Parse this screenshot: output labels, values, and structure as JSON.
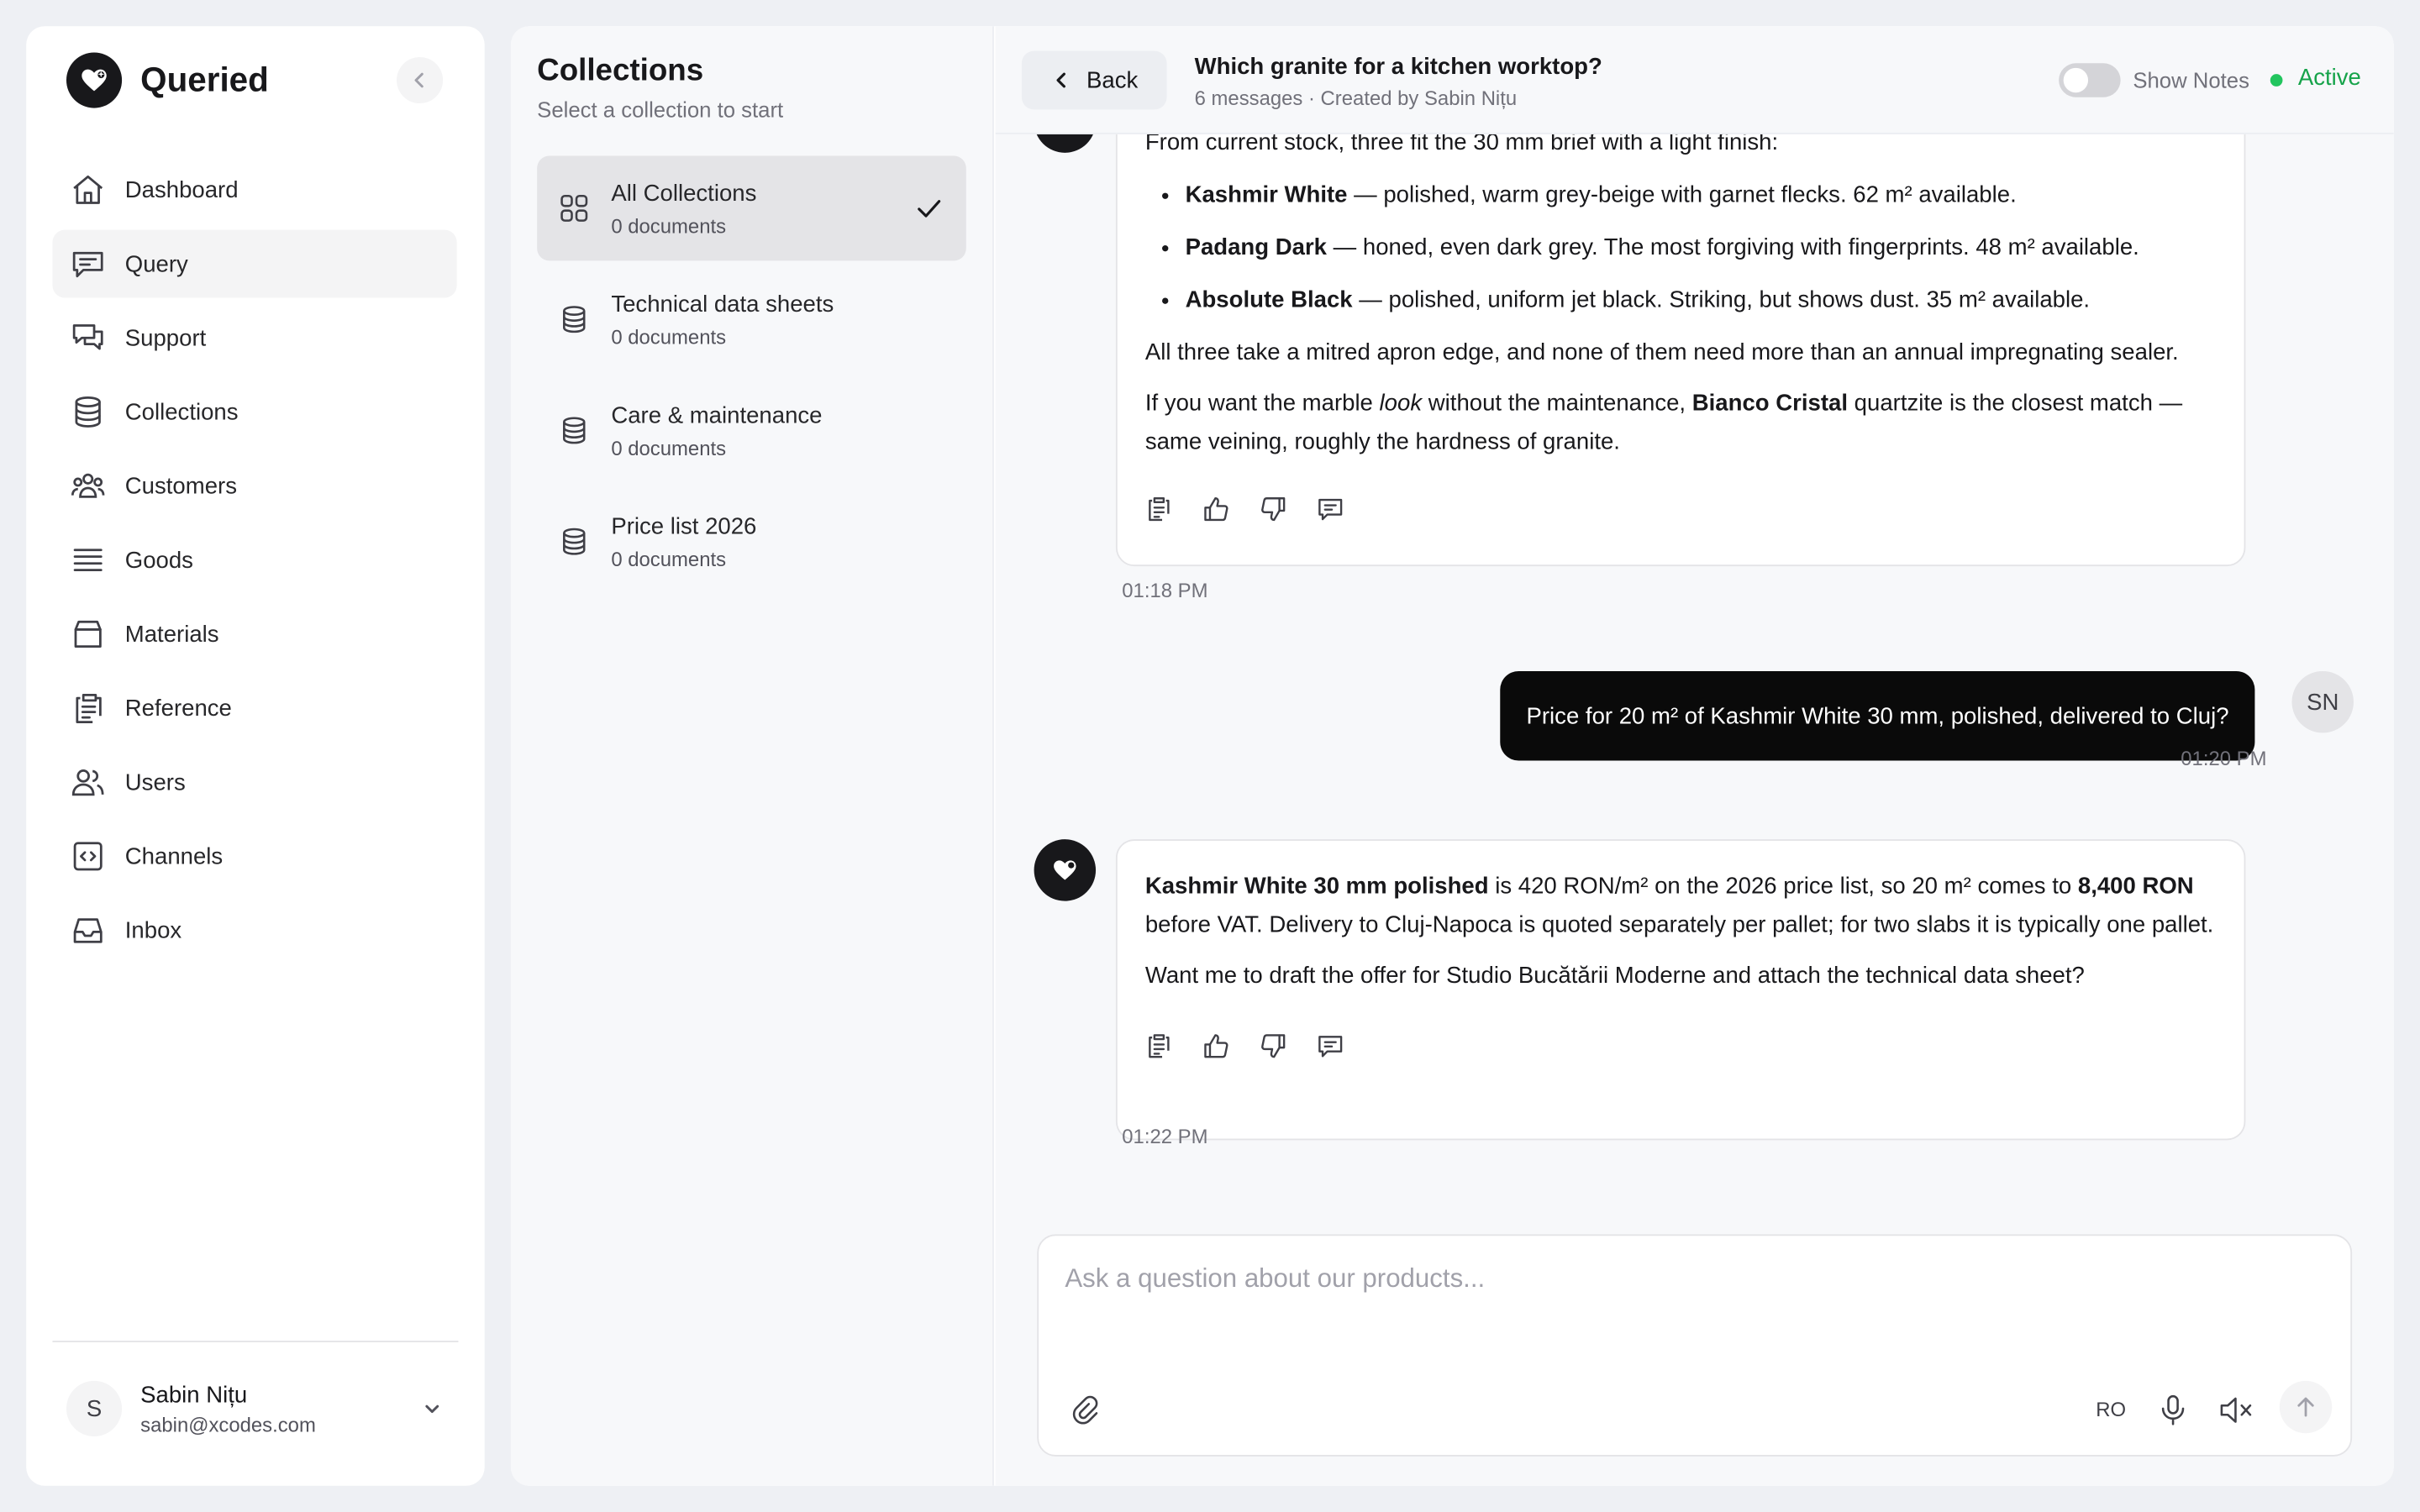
{
  "brand": {
    "name": "Queried"
  },
  "sidebar": {
    "items": [
      {
        "label": "Dashboard",
        "icon": "home-icon"
      },
      {
        "label": "Query",
        "icon": "message-icon",
        "active": true
      },
      {
        "label": "Support",
        "icon": "chat-bubbles-icon"
      },
      {
        "label": "Collections",
        "icon": "database-icon"
      },
      {
        "label": "Customers",
        "icon": "customers-icon"
      },
      {
        "label": "Goods",
        "icon": "list-icon"
      },
      {
        "label": "Materials",
        "icon": "box-icon"
      },
      {
        "label": "Reference",
        "icon": "clipboard-icon"
      },
      {
        "label": "Users",
        "icon": "users-icon"
      },
      {
        "label": "Channels",
        "icon": "code-icon"
      },
      {
        "label": "Inbox",
        "icon": "inbox-icon"
      }
    ],
    "user": {
      "initial": "S",
      "name": "Sabin Nițu",
      "email": "sabin@xcodes.com"
    }
  },
  "collections": {
    "title": "Collections",
    "subtitle": "Select a collection to start",
    "items": [
      {
        "name": "All Collections",
        "count": "0 documents",
        "selected": true
      },
      {
        "name": "Technical data sheets",
        "count": "0 documents"
      },
      {
        "name": "Care & maintenance",
        "count": "0 documents"
      },
      {
        "name": "Price list 2026",
        "count": "0 documents"
      }
    ]
  },
  "chat": {
    "back_label": "Back",
    "title": "Which granite for a kitchen worktop?",
    "meta": "6 messages · Created by Sabin Nițu",
    "notes_label": "Show Notes",
    "status": "Active",
    "status_color": "#16a34a",
    "messages": [
      {
        "role": "assistant",
        "intro": "From current stock, three fit the 30 mm brief with a light finish:",
        "bullets": [
          {
            "name": "Kashmir White",
            "text": " — polished, warm grey-beige with garnet flecks. 62 m² available."
          },
          {
            "name": "Padang Dark",
            "text": " — honed, even dark grey. The most forgiving with fingerprints. 48 m² available."
          },
          {
            "name": "Absolute Black",
            "text": " — polished, uniform jet black. Striking, but shows dust. 35 m² available."
          }
        ],
        "p1": "All three take a mitred apron edge, and none of them need more than an annual impregnating sealer.",
        "p2_a": "If you want the marble ",
        "p2_em": "look",
        "p2_b": " without the maintenance, ",
        "p2_strong": "Bianco Cristal",
        "p2_c": " quartzite is the closest match — same veining, roughly the hardness of granite.",
        "time": "01:18 PM"
      },
      {
        "role": "user",
        "text": "Price for 20 m² of Kashmir White 30 mm, polished, delivered to Cluj?",
        "initials": "SN",
        "time": "01:20 PM"
      },
      {
        "role": "assistant",
        "p1_strong": "Kashmir White 30 mm polished",
        "p1_a": " is 420 RON/m² on the 2026 price list, so 20 m² comes to ",
        "p1_strong2": "8,400 RON",
        "p1_b": " before VAT. Delivery to Cluj-Napoca is quoted separately per pallet; for two slabs it is typically one pallet.",
        "p2": "Want me to draft the offer for Studio Bucătării Moderne and attach the technical data sheet?",
        "time": "01:22 PM"
      }
    ]
  },
  "composer": {
    "placeholder": "Ask a question about our products...",
    "value": "",
    "language": "RO"
  }
}
